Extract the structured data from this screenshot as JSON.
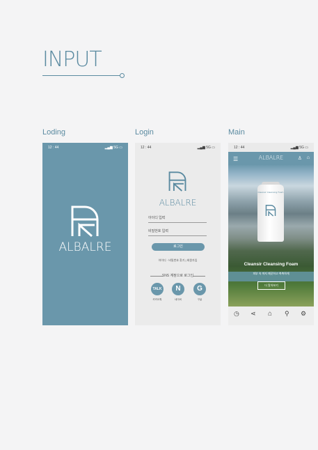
{
  "section_title": "INPUT",
  "screens": [
    {
      "label": "Loding"
    },
    {
      "label": "Login"
    },
    {
      "label": "Main"
    }
  ],
  "status_bar": {
    "time": "12 : 44",
    "signal": "5G"
  },
  "brand": "ALBALRE",
  "login": {
    "id_placeholder": "아이디 입력",
    "pw_placeholder": "비밀번호 입력",
    "login_button": "로그인",
    "find_links": "아이디 · 비밀번호 찾기 | 회원가입",
    "sns_title": "SNS 계정으로 로그인",
    "sns": [
      {
        "label": "카카오톡",
        "glyph": "TALK",
        "icon": "kakao-icon"
      },
      {
        "label": "네이버",
        "glyph": "N",
        "icon": "naver-icon"
      },
      {
        "label": "구글",
        "glyph": "G",
        "icon": "google-icon"
      }
    ]
  },
  "main": {
    "product_name": "Cleansir Cleansing Foam",
    "product_desc": "피부 속 까지 깨끗하고 촉촉하게",
    "more_button": "더 알아보기",
    "tube_text": "Cleansir Cleansing Foam",
    "nav": [
      {
        "icon": "clock-icon"
      },
      {
        "icon": "share-icon"
      },
      {
        "icon": "home-icon"
      },
      {
        "icon": "search-icon"
      },
      {
        "icon": "settings-icon"
      }
    ]
  },
  "colors": {
    "accent": "#6a97ab",
    "background": "#f4f4f5"
  }
}
